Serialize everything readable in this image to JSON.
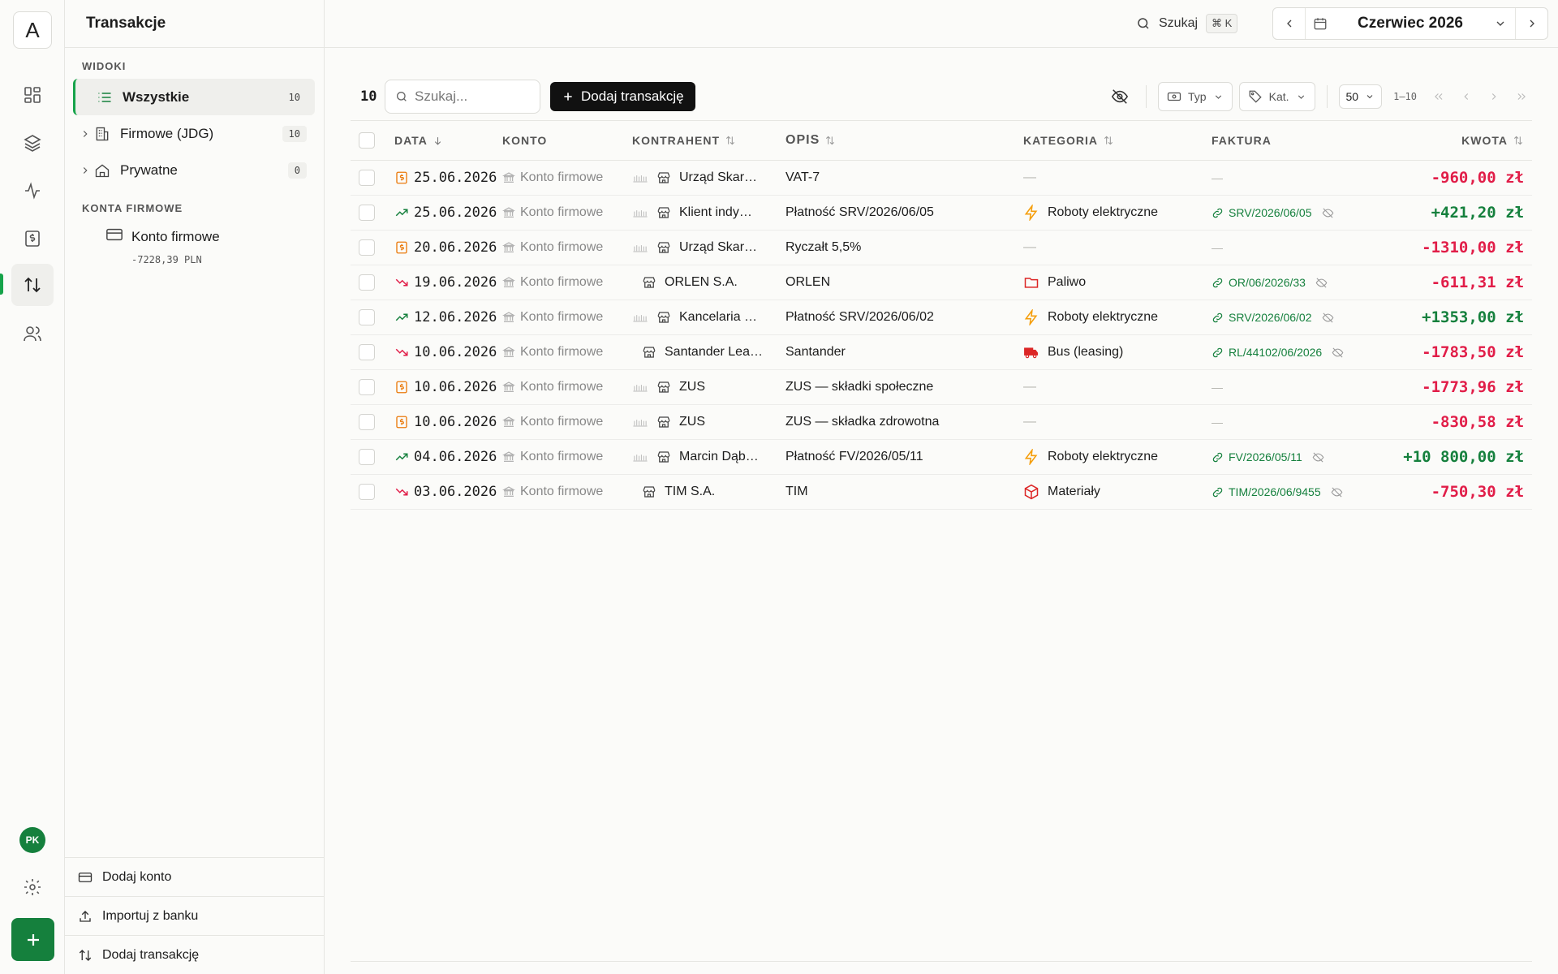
{
  "app": {
    "logo": "A",
    "page_title": "Transakcje"
  },
  "rail": {
    "items": [
      {
        "icon": "dashboard-icon"
      },
      {
        "icon": "layers-icon"
      },
      {
        "icon": "activity-icon"
      },
      {
        "icon": "invoice-icon"
      },
      {
        "icon": "transfer-icon",
        "active": true
      },
      {
        "icon": "users-icon"
      }
    ],
    "avatar": "PK"
  },
  "sidebar": {
    "views_label": "WIDOKI",
    "views": [
      {
        "label": "Wszystkie",
        "count": "10",
        "icon": "list-icon",
        "active": true
      },
      {
        "label": "Firmowe (JDG)",
        "count": "10",
        "icon": "building-icon"
      },
      {
        "label": "Prywatne",
        "count": "0",
        "icon": "home-icon"
      }
    ],
    "accounts_label": "KONTA FIRMOWE",
    "accounts": [
      {
        "name": "Konto firmowe",
        "balance": "-7228,39 PLN",
        "icon": "card-icon"
      }
    ],
    "footer": [
      {
        "label": "Dodaj konto",
        "icon": "card-icon"
      },
      {
        "label": "Importuj z banku",
        "icon": "upload-icon"
      },
      {
        "label": "Dodaj transakcję",
        "icon": "transfer-icon"
      }
    ]
  },
  "topbar": {
    "search_label": "Szukaj",
    "shortcut": "⌘ K",
    "month": "Czerwiec 2026"
  },
  "toolbar": {
    "count": "10",
    "search_placeholder": "Szukaj...",
    "add_label": "Dodaj transakcję",
    "type_filter": "Typ",
    "cat_filter": "Kat.",
    "page_size": "50",
    "range": "1–10"
  },
  "table": {
    "headers": {
      "date": "DATA",
      "account": "KONTO",
      "contractor": "KONTRAHENT",
      "description": "OPIS",
      "category": "KATEGORIA",
      "invoice": "FAKTURA",
      "amount": "KWOTA"
    },
    "rows": [
      {
        "type": "tax",
        "date": "25.06.2026",
        "account": "Konto firmowe",
        "contractor": "Urząd Skar…",
        "contractor_prefix": true,
        "description": "VAT-7",
        "category": "—",
        "category_icon": "",
        "invoice": "—",
        "amount": "-960,00 zł",
        "sign": "neg"
      },
      {
        "type": "income",
        "date": "25.06.2026",
        "account": "Konto firmowe",
        "contractor": "Klient indy…",
        "contractor_prefix": true,
        "description": "Płatność SRV/2026/06/05",
        "category": "Roboty elektryczne",
        "category_icon": "bolt-icon",
        "invoice": "SRV/2026/06/05",
        "amount": "+421,20 zł",
        "sign": "pos"
      },
      {
        "type": "tax",
        "date": "20.06.2026",
        "account": "Konto firmowe",
        "contractor": "Urząd Skar…",
        "contractor_prefix": true,
        "description": "Ryczałt 5,5%",
        "category": "—",
        "category_icon": "",
        "invoice": "—",
        "amount": "-1310,00 zł",
        "sign": "neg"
      },
      {
        "type": "expense",
        "date": "19.06.2026",
        "account": "Konto firmowe",
        "contractor": "ORLEN S.A.",
        "contractor_prefix": false,
        "description": "ORLEN",
        "category": "Paliwo",
        "category_icon": "folder-icon",
        "invoice": "OR/06/2026/33",
        "amount": "-611,31 zł",
        "sign": "neg"
      },
      {
        "type": "income",
        "date": "12.06.2026",
        "account": "Konto firmowe",
        "contractor": "Kancelaria …",
        "contractor_prefix": true,
        "description": "Płatność SRV/2026/06/02",
        "category": "Roboty elektryczne",
        "category_icon": "bolt-icon",
        "invoice": "SRV/2026/06/02",
        "amount": "+1353,00 zł",
        "sign": "pos"
      },
      {
        "type": "expense",
        "date": "10.06.2026",
        "account": "Konto firmowe",
        "contractor": "Santander Lea…",
        "contractor_prefix": false,
        "description": "Santander",
        "category": "Bus (leasing)",
        "category_icon": "truck-icon",
        "invoice": "RL/44102/06/2026",
        "amount": "-1783,50 zł",
        "sign": "neg"
      },
      {
        "type": "tax",
        "date": "10.06.2026",
        "account": "Konto firmowe",
        "contractor": "ZUS",
        "contractor_prefix": true,
        "description": "ZUS — składki społeczne",
        "category": "—",
        "category_icon": "",
        "invoice": "—",
        "amount": "-1773,96 zł",
        "sign": "neg"
      },
      {
        "type": "tax",
        "date": "10.06.2026",
        "account": "Konto firmowe",
        "contractor": "ZUS",
        "contractor_prefix": true,
        "description": "ZUS — składka zdrowotna",
        "category": "—",
        "category_icon": "",
        "invoice": "—",
        "amount": "-830,58 zł",
        "sign": "neg"
      },
      {
        "type": "income",
        "date": "04.06.2026",
        "account": "Konto firmowe",
        "contractor": "Marcin Dąb…",
        "contractor_prefix": true,
        "description": "Płatność FV/2026/05/11",
        "category": "Roboty elektryczne",
        "category_icon": "bolt-icon",
        "invoice": "FV/2026/05/11",
        "amount": "+10 800,00 zł",
        "sign": "pos"
      },
      {
        "type": "expense",
        "date": "03.06.2026",
        "account": "Konto firmowe",
        "contractor": "TIM S.A.",
        "contractor_prefix": false,
        "description": "TIM",
        "category": "Materiały",
        "category_icon": "box-icon",
        "invoice": "TIM/2026/06/9455",
        "amount": "-750,30 zł",
        "sign": "neg"
      }
    ]
  },
  "colors": {
    "accent": "#15803d",
    "negative": "#e11d48",
    "positive": "#15803d",
    "tax": "#ea7a0c",
    "category_bolt": "#f59e0b",
    "category_red": "#dc2626"
  }
}
